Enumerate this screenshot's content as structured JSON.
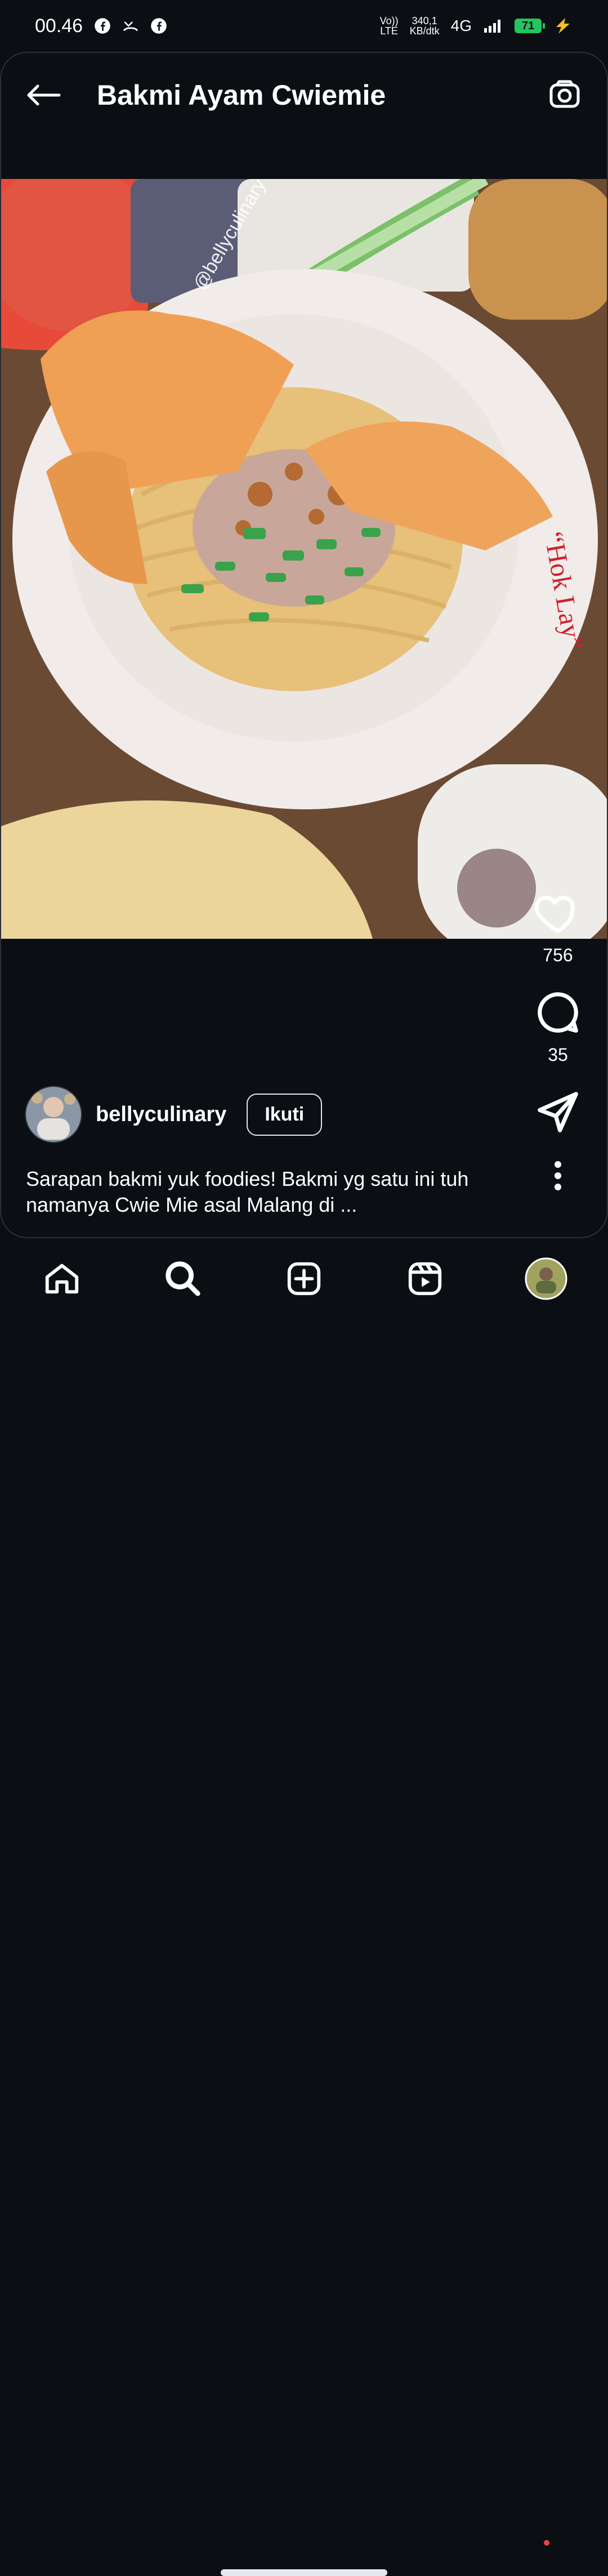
{
  "status_bar": {
    "time": "00.46",
    "net_volte_top": "Vo))",
    "net_volte_bottom": "LTE",
    "speed_top": "340,1",
    "speed_bottom": "KB/dtk",
    "network": "4G",
    "battery": "71",
    "icons": [
      "facebook-icon",
      "missed-call-icon",
      "facebook-icon",
      "signal-icon",
      "battery-icon",
      "charging-icon"
    ]
  },
  "header": {
    "title": "Bakmi Ayam Cwiemie",
    "back_icon": "arrow-left-icon",
    "camera_icon": "camera-icon"
  },
  "post": {
    "image_alt": "Bowl of bakmi noodles with fried wontons and scallions",
    "watermark": "@bellyculinary",
    "bowl_text": "“Hok Lay”",
    "likes": "756",
    "comments": "35",
    "username": "bellyculinary",
    "follow_label": "Ikuti",
    "caption": "Sarapan bakmi yuk foodies! Bakmi yg satu ini tuh namanya Cwie Mie asal Malang di ..."
  },
  "nav": {
    "items": [
      "home-icon",
      "search-icon",
      "add-icon",
      "reels-icon",
      "profile-avatar"
    ]
  },
  "colors": {
    "background": "#0b0f14",
    "accent": "#ef4444",
    "battery": "#22c55e"
  }
}
